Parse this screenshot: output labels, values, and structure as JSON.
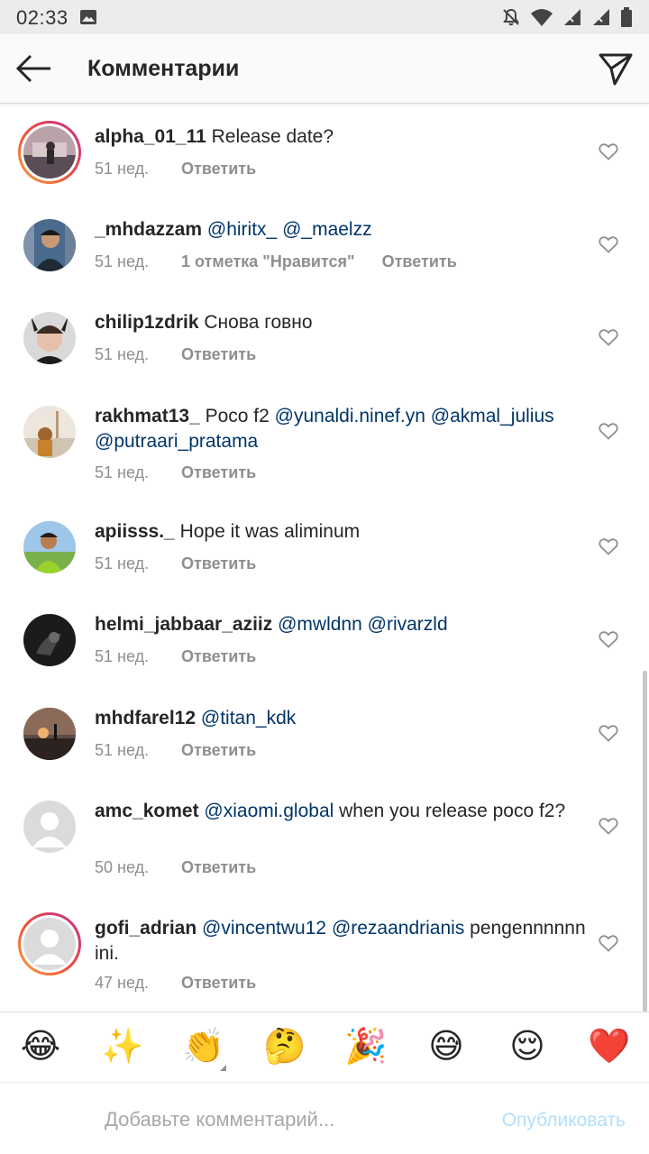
{
  "status_bar": {
    "time": "02:33"
  },
  "header": {
    "title": "Комментарии"
  },
  "comments": [
    {
      "username": "alpha_01_11",
      "text": "Release date?",
      "time": "51 нед.",
      "reply": "Ответить"
    },
    {
      "username": "_mhdazzam",
      "mention1": "@hiritx_",
      "mention2": "@_maelzz",
      "time": "51 нед.",
      "likes": "1 отметка \"Нравится\"",
      "reply": "Ответить"
    },
    {
      "username": "chilip1zdrik",
      "text": "Снова говно",
      "time": "51 нед.",
      "reply": "Ответить"
    },
    {
      "username": "rakhmat13_",
      "text": "Poco f2",
      "mention1": "@yunaldi.ninef.yn",
      "mention2": "@akmal_julius",
      "mention3": "@putraari_pratama",
      "time": "51 нед.",
      "reply": "Ответить"
    },
    {
      "username": "apiisss._",
      "text": "Hope it was aliminum",
      "time": "51 нед.",
      "reply": "Ответить"
    },
    {
      "username": "helmi_jabbaar_aziiz",
      "mention1": "@mwldnn",
      "mention2": "@rivarzld",
      "time": "51 нед.",
      "reply": "Ответить"
    },
    {
      "username": "mhdfarel12",
      "mention1": "@titan_kdk",
      "time": "51 нед.",
      "reply": "Ответить"
    },
    {
      "username": "amc_komet",
      "mention1": "@xiaomi.global",
      "text": "when you release poco f2?",
      "time": "50 нед.",
      "reply": "Ответить"
    },
    {
      "username": "gofi_adrian",
      "mention1": "@vincentwu12",
      "mention2": "@rezaandrianis",
      "text": "pengennnnnn ini.",
      "time": "47 нед.",
      "reply": "Ответить"
    }
  ],
  "emojis": [
    "😂",
    "✨",
    "👏",
    "🤔",
    "🎉",
    "😅",
    "😌",
    "❤️"
  ],
  "input": {
    "placeholder": "Добавьте комментарий...",
    "publish_label": "Опубликовать"
  },
  "colors": {
    "mention": "#003569",
    "meta": "#8e8e8e",
    "publish_disabled": "#b2dffc",
    "story_ring_start": "#f9a63b",
    "story_ring_end": "#c2308f"
  }
}
